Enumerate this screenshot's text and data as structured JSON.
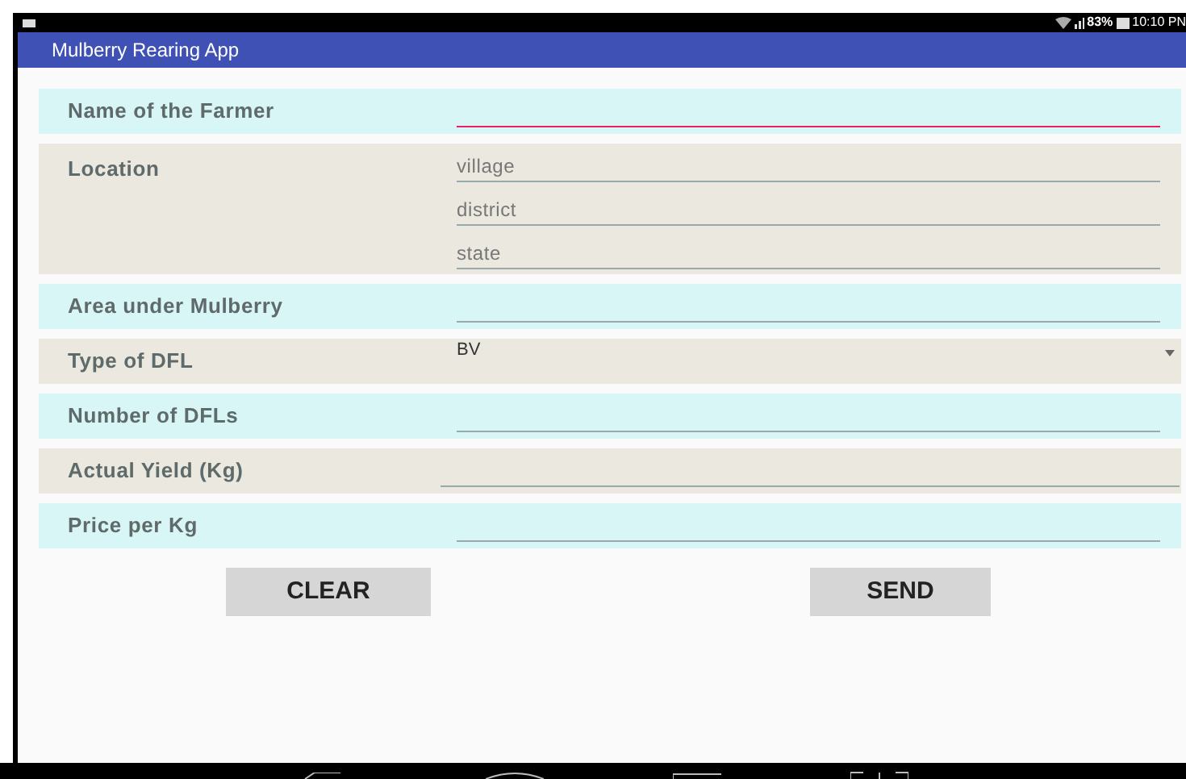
{
  "status_bar": {
    "battery": "83%",
    "time": "10:10 PN"
  },
  "app_bar": {
    "title": "Mulberry Rearing App"
  },
  "form": [
    {
      "kind": "text",
      "label": "Name of the Farmer",
      "focused": true
    },
    {
      "kind": "multi",
      "label": "Location",
      "fields": [
        {
          "placeholder": "village"
        },
        {
          "placeholder": "district"
        },
        {
          "placeholder": "state"
        }
      ]
    },
    {
      "kind": "text",
      "label": "Area under Mulberry",
      "focused": false
    },
    {
      "kind": "spinner",
      "label": "Type of DFL",
      "value": "BV"
    },
    {
      "kind": "text",
      "label": "Number of DFLs",
      "focused": false
    },
    {
      "kind": "wide",
      "label": "Actual Yield (Kg)",
      "focused": false
    },
    {
      "kind": "text",
      "label": "Price per Kg",
      "focused": false
    }
  ],
  "buttons": [
    "CLEAR",
    "SEND"
  ]
}
